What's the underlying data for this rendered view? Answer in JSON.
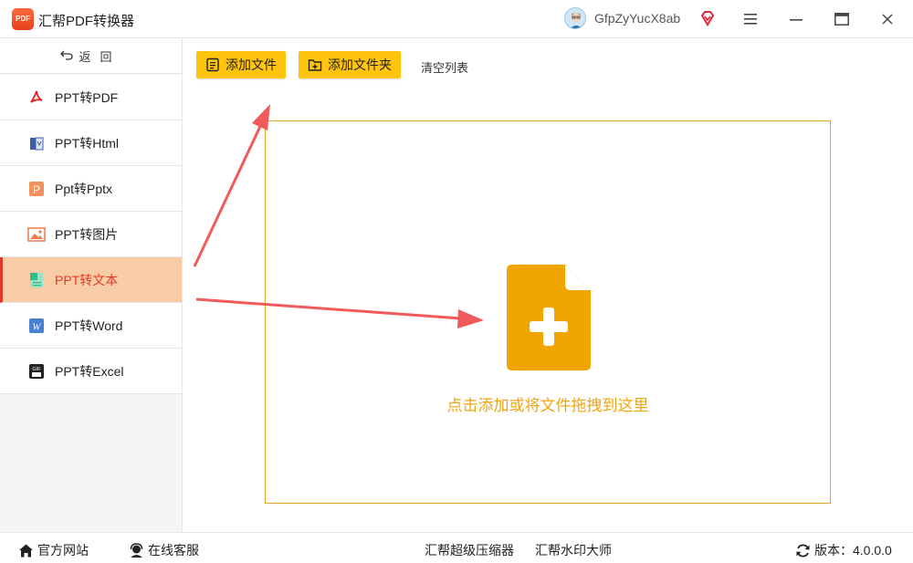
{
  "titlebar": {
    "logo_text": "PDF",
    "title": "汇帮PDF转换器",
    "username": "GfpZyYucX8ab"
  },
  "sidebar": {
    "back_label": "返回",
    "items": [
      {
        "label": "PPT转PDF",
        "icon": "pdf-icon"
      },
      {
        "label": "PPT转Html",
        "icon": "html-icon"
      },
      {
        "label": "Ppt转Pptx",
        "icon": "pptx-icon"
      },
      {
        "label": "PPT转图片",
        "icon": "image-icon"
      },
      {
        "label": "PPT转文本",
        "icon": "text-icon",
        "active": true
      },
      {
        "label": "PPT转Word",
        "icon": "word-icon"
      },
      {
        "label": "PPT转Excel",
        "icon": "excel-icon"
      }
    ]
  },
  "toolbar": {
    "add_file": "添加文件",
    "add_folder": "添加文件夹",
    "clear_list": "清空列表"
  },
  "dropzone": {
    "text": "点击添加或将文件拖拽到这里"
  },
  "footer": {
    "website": "官方网站",
    "support": "在线客服",
    "compressor": "汇帮超级压缩器",
    "watermark": "汇帮水印大师",
    "version": "版本：4.0.0.0"
  },
  "colors": {
    "accent_yellow": "#ffc40e",
    "drop_orange": "#f0a50e",
    "active_bg": "#f8cca5",
    "active_red": "#e03a2a",
    "arrow_red": "#f05a5a"
  }
}
